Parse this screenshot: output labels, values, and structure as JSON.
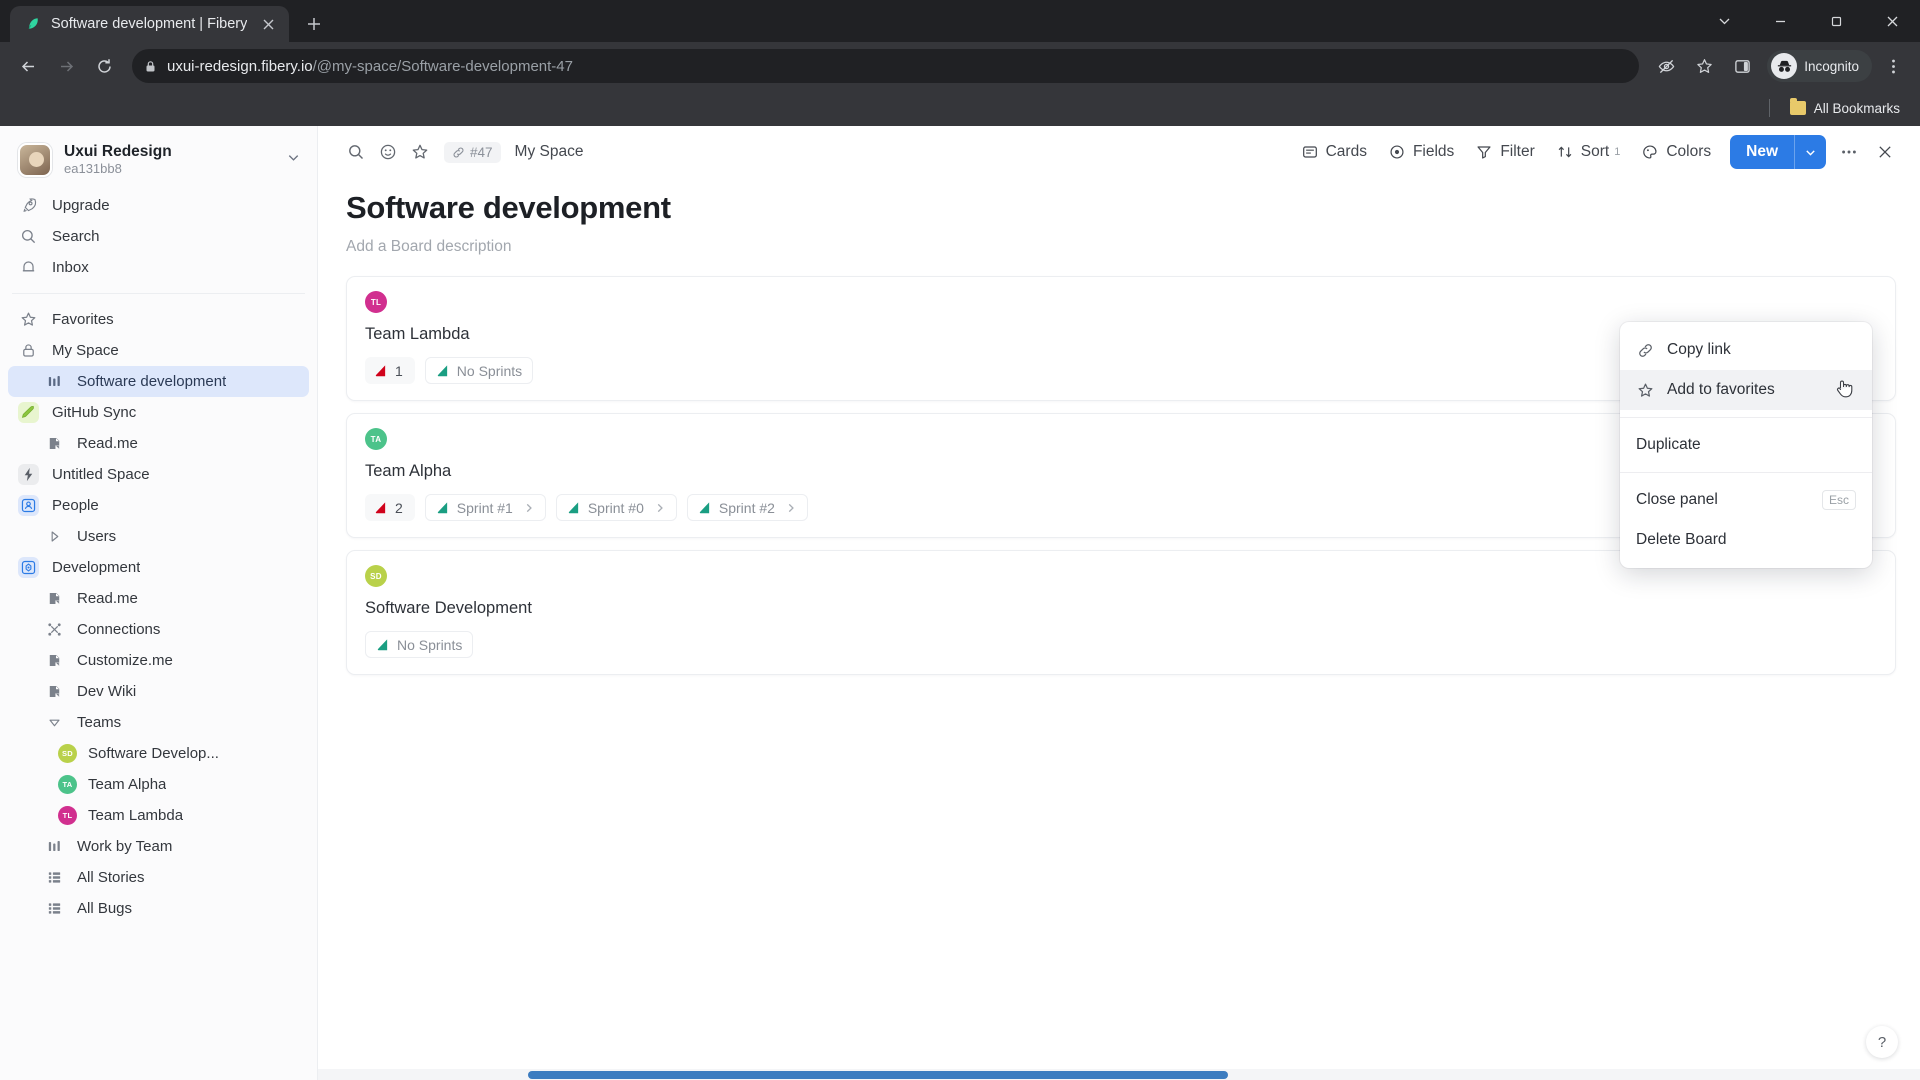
{
  "browser": {
    "tab": {
      "title": "Software development | Fibery",
      "favicon": "fibery-leaf-icon"
    },
    "new_tab_label": "+",
    "url_domain": "uxui-redesign.fibery.io",
    "url_path": "/@my-space/Software-development-47",
    "profile_label": "Incognito",
    "bookmarks_label": "All Bookmarks",
    "window_controls": [
      "tab-search",
      "minimize",
      "maximize",
      "close"
    ]
  },
  "sidebar": {
    "workspace": {
      "name": "Uxui Redesign",
      "id": "ea131bb8"
    },
    "primary": [
      {
        "label": "Upgrade",
        "icon": "rocket-icon"
      },
      {
        "label": "Search",
        "icon": "search-icon"
      },
      {
        "label": "Inbox",
        "icon": "bell-icon"
      }
    ],
    "items": [
      {
        "label": "Favorites",
        "icon": "star-icon",
        "level": 0
      },
      {
        "label": "My Space",
        "icon": "lock-icon",
        "level": 0
      },
      {
        "label": "Software development",
        "icon": "board-icon",
        "level": 1,
        "active": true
      },
      {
        "label": "GitHub Sync",
        "icon": "github-sync-icon",
        "level": 0,
        "iconbg": "#e8f5cf",
        "iconcolor": "#7cb342"
      },
      {
        "label": "Read.me",
        "icon": "document-icon",
        "level": 1
      },
      {
        "label": "Untitled Space",
        "icon": "lightning-icon",
        "level": 0,
        "iconbg": "#ebecee",
        "iconcolor": "#5a5f67"
      },
      {
        "label": "People",
        "icon": "people-icon",
        "level": 0,
        "iconbg": "#dde7fb",
        "iconcolor": "#2c7be5"
      },
      {
        "label": "Users",
        "icon": "triangle-right-icon",
        "level": 1
      },
      {
        "label": "Development",
        "icon": "development-icon",
        "level": 0,
        "iconbg": "#dde7fb",
        "iconcolor": "#2c7be5"
      },
      {
        "label": "Read.me",
        "icon": "document-icon",
        "level": 1
      },
      {
        "label": "Connections",
        "icon": "connections-icon",
        "level": 1
      },
      {
        "label": "Customize.me",
        "icon": "document-icon",
        "level": 1
      },
      {
        "label": "Dev Wiki",
        "icon": "document-icon",
        "level": 1
      },
      {
        "label": "Teams",
        "icon": "triangle-down-icon",
        "level": 1
      },
      {
        "label": "Software Develop...",
        "icon": "avatar",
        "level": 2,
        "avatar": "SD",
        "color": "#b9d14a"
      },
      {
        "label": "Team Alpha",
        "icon": "avatar",
        "level": 2,
        "avatar": "TA",
        "color": "#4cc38a"
      },
      {
        "label": "Team Lambda",
        "icon": "avatar",
        "level": 2,
        "avatar": "TL",
        "color": "#d12f8f"
      },
      {
        "label": "Work by Team",
        "icon": "board-icon",
        "level": 1
      },
      {
        "label": "All Stories",
        "icon": "grid-icon",
        "level": 1
      },
      {
        "label": "All Bugs",
        "icon": "grid-icon",
        "level": 1
      }
    ]
  },
  "main": {
    "topbar": {
      "search_icon": "search-icon",
      "emoji_icon": "smiley-icon",
      "star_icon": "star-icon",
      "id_badge": "#47",
      "breadcrumb": "My Space",
      "actions": [
        {
          "label": "Cards",
          "icon": "cards-icon"
        },
        {
          "label": "Fields",
          "icon": "fields-icon"
        },
        {
          "label": "Filter",
          "icon": "filter-icon"
        },
        {
          "label": "Sort",
          "icon": "sort-icon",
          "count": "1"
        },
        {
          "label": "Colors",
          "icon": "colors-icon"
        }
      ],
      "new_button": "New",
      "more_icon": "ellipsis-icon",
      "close_icon": "close-icon"
    },
    "title": "Software development",
    "description_placeholder": "Add a Board description",
    "cards": [
      {
        "avatar": "TL",
        "color": "#d12f8f",
        "title": "Team Lambda",
        "chips": [
          {
            "label": "1",
            "type": "count",
            "flag": "red"
          },
          {
            "label": "No Sprints",
            "type": "plain",
            "flag": "teal"
          }
        ]
      },
      {
        "avatar": "TA",
        "color": "#4cc38a",
        "title": "Team Alpha",
        "chips": [
          {
            "label": "2",
            "type": "count",
            "flag": "red"
          },
          {
            "label": "Sprint #1",
            "type": "link",
            "flag": "teal"
          },
          {
            "label": "Sprint #0",
            "type": "link",
            "flag": "teal"
          },
          {
            "label": "Sprint #2",
            "type": "link",
            "flag": "teal"
          }
        ]
      },
      {
        "avatar": "SD",
        "color": "#b9d14a",
        "title": "Software Development",
        "chips": [
          {
            "label": "No Sprints",
            "type": "plain",
            "flag": "teal"
          }
        ]
      }
    ],
    "help_label": "?"
  },
  "context_menu": {
    "items": [
      {
        "label": "Copy link",
        "icon": "link-icon",
        "hover": false
      },
      {
        "label": "Add to favorites",
        "icon": "star-icon",
        "hover": true
      },
      {
        "label": "Duplicate",
        "icon": null,
        "hover": false,
        "sep_before": true
      },
      {
        "label": "Close panel",
        "icon": null,
        "hover": false,
        "kbd": "Esc",
        "sep_before": true
      },
      {
        "label": "Delete Board",
        "icon": null,
        "hover": false
      }
    ]
  },
  "colors": {
    "accent": "#2c7be5",
    "active_nav_bg": "#dde7fb",
    "scrollbar": "#3c7cc0"
  }
}
